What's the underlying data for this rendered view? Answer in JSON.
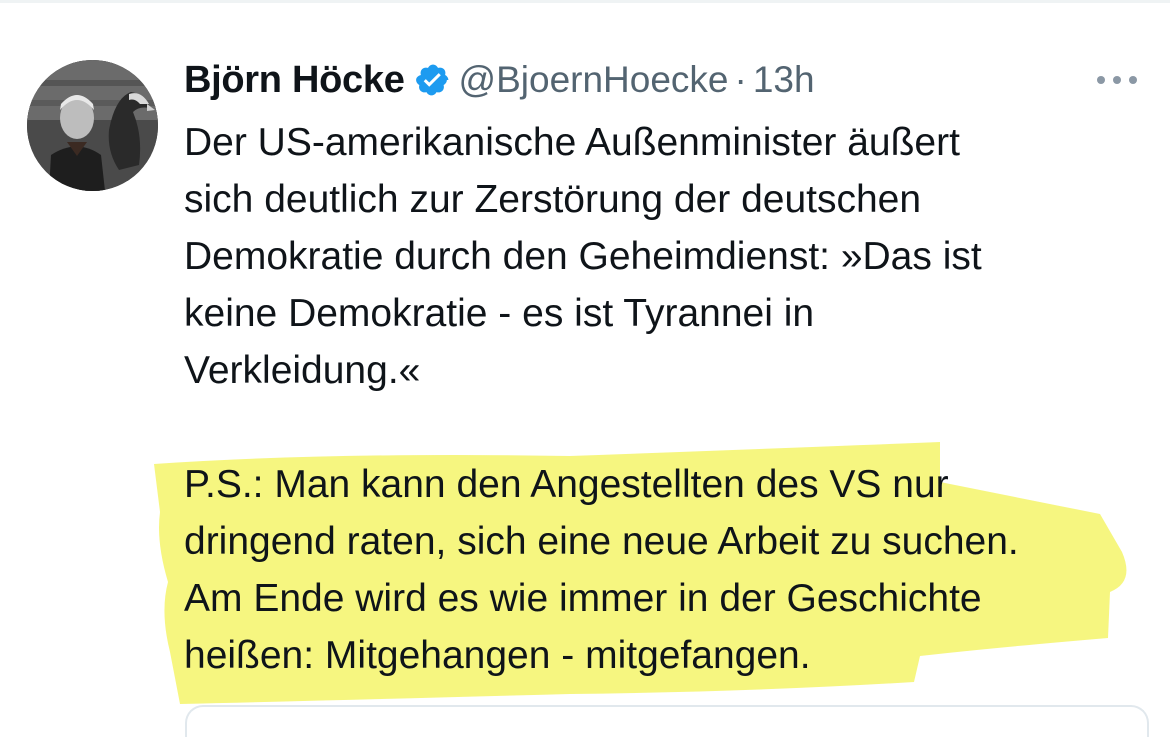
{
  "tweet": {
    "author": {
      "display_name": "Björn Höcke",
      "handle": "@BjoernHoecke",
      "verified_icon": "verified-badge-icon"
    },
    "separator": "·",
    "timestamp": "13h",
    "more_icon": "more-options-icon",
    "lines": [
      "Der US-amerikanische Außenminister äußert",
      "sich deutlich zur Zerstörung der deutschen",
      "Demokratie durch den Geheimdienst:  »Das ist",
      "keine Demokratie - es ist Tyrannei in",
      "Verkleidung.«",
      "P.S.: Man kann den Angestellten des VS nur",
      "dringend raten, sich eine neue Arbeit zu suchen.",
      "Am Ende wird es wie immer in der Geschichte",
      "heißen: Mitgehangen - mitgefangen."
    ]
  },
  "colors": {
    "text": "#0f1419",
    "secondary_text": "#536471",
    "verified_blue": "#1d9bf0",
    "highlight_yellow": "#f4f46a"
  }
}
